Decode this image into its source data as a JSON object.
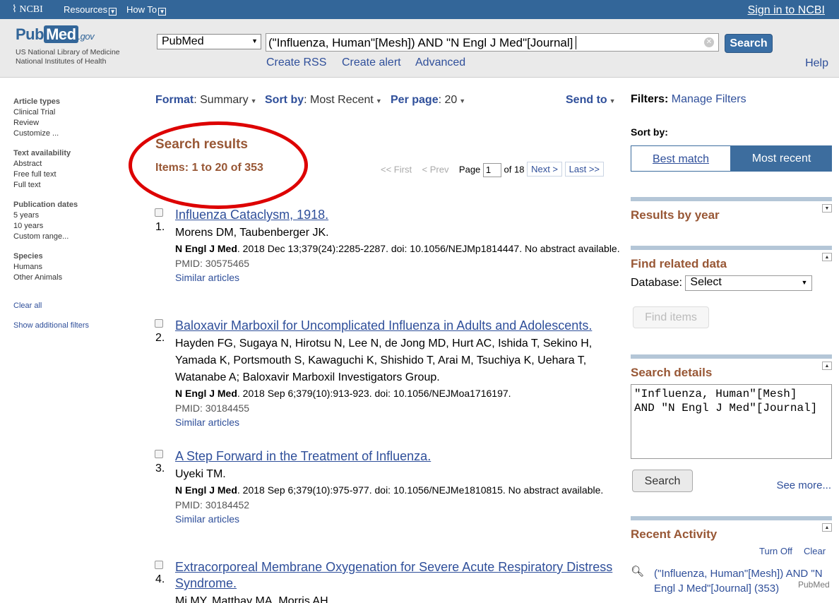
{
  "topbar": {
    "ncbi": "NCBI",
    "resources": "Resources",
    "howto": "How To",
    "signin": "Sign in to NCBI"
  },
  "header": {
    "logo_pub": "Pub",
    "logo_med": "Med",
    "logo_gov": ".gov",
    "nlm1": "US National Library of Medicine",
    "nlm2": "National Institutes of Health",
    "db": "PubMed",
    "query": "(\"Influenza, Human\"[Mesh]) AND \"N Engl J Med\"[Journal]",
    "search": "Search",
    "rss": "Create RSS",
    "alert": "Create alert",
    "advanced": "Advanced",
    "help": "Help"
  },
  "sidebar": {
    "article_types": "Article types",
    "clinical_trial": "Clinical Trial",
    "review": "Review",
    "customize": "Customize ...",
    "text_avail": "Text availability",
    "abstract": "Abstract",
    "free_full": "Free full text",
    "full_text": "Full text",
    "pub_dates": "Publication dates",
    "y5": "5 years",
    "y10": "10 years",
    "custom_range": "Custom range...",
    "species": "Species",
    "humans": "Humans",
    "other_animals": "Other Animals",
    "clear_all": "Clear all",
    "show_more": "Show additional filters"
  },
  "toolbar": {
    "format_label": "Format",
    "format_value": "Summary",
    "sort_label": "Sort by",
    "sort_value": "Most Recent",
    "per_page_label": "Per page",
    "per_page_value": "20",
    "send_to": "Send to"
  },
  "results_header": {
    "title": "Search results",
    "items": "Items: 1 to 20 of 353"
  },
  "pager": {
    "first": "<< First",
    "prev": "< Prev",
    "page_label": "Page",
    "page": "1",
    "of": "of 18",
    "next": "Next >",
    "last": "Last >>"
  },
  "results": [
    {
      "num": "1.",
      "title": "Influenza Cataclysm, 1918.",
      "authors": "Morens DM, Taubenberger JK.",
      "journal": "N Engl J Med",
      "cite": ". 2018 Dec 13;379(24):2285-2287. doi: 10.1056/NEJMp1814447. No abstract available.",
      "pmid": "PMID: 30575465",
      "similar": "Similar articles"
    },
    {
      "num": "2.",
      "title": "Baloxavir Marboxil for Uncomplicated Influenza in Adults and Adolescents.",
      "authors": "Hayden FG, Sugaya N, Hirotsu N, Lee N, de Jong MD, Hurt AC, Ishida T, Sekino H, Yamada K, Portsmouth S, Kawaguchi K, Shishido T, Arai M, Tsuchiya K, Uehara T, Watanabe A; Baloxavir Marboxil Investigators Group.",
      "journal": "N Engl J Med",
      "cite": ". 2018 Sep 6;379(10):913-923. doi: 10.1056/NEJMoa1716197.",
      "pmid": "PMID: 30184455",
      "similar": "Similar articles"
    },
    {
      "num": "3.",
      "title": "A Step Forward in the Treatment of Influenza.",
      "authors": "Uyeki TM.",
      "journal": "N Engl J Med",
      "cite": ". 2018 Sep 6;379(10):975-977. doi: 10.1056/NEJMe1810815. No abstract available.",
      "pmid": "PMID: 30184452",
      "similar": "Similar articles"
    },
    {
      "num": "4.",
      "title": "Extracorporeal Membrane Oxygenation for Severe Acute Respiratory Distress Syndrome.",
      "authors": "Mi MY, Matthay MA, Morris AH."
    }
  ],
  "right": {
    "filters": "Filters:",
    "manage": "Manage Filters",
    "sort_by": "Sort by:",
    "best": "Best match",
    "recent": "Most recent",
    "by_year": "Results by year",
    "related": "Find related data",
    "database_label": "Database:",
    "database_value": "Select",
    "find_items": "Find items",
    "details": "Search details",
    "details_text": "\"Influenza, Human\"[Mesh]\nAND \"N Engl J Med\"[Journal]",
    "details_search": "Search",
    "see_more": "See more...",
    "recent_activity": "Recent Activity",
    "turn_off": "Turn Off",
    "clear": "Clear",
    "activity_item": "(\"Influenza, Human\"[Mesh]) AND \"N Engl J Med\"[Journal] (353)",
    "pubmed_tag": "PubMed"
  }
}
